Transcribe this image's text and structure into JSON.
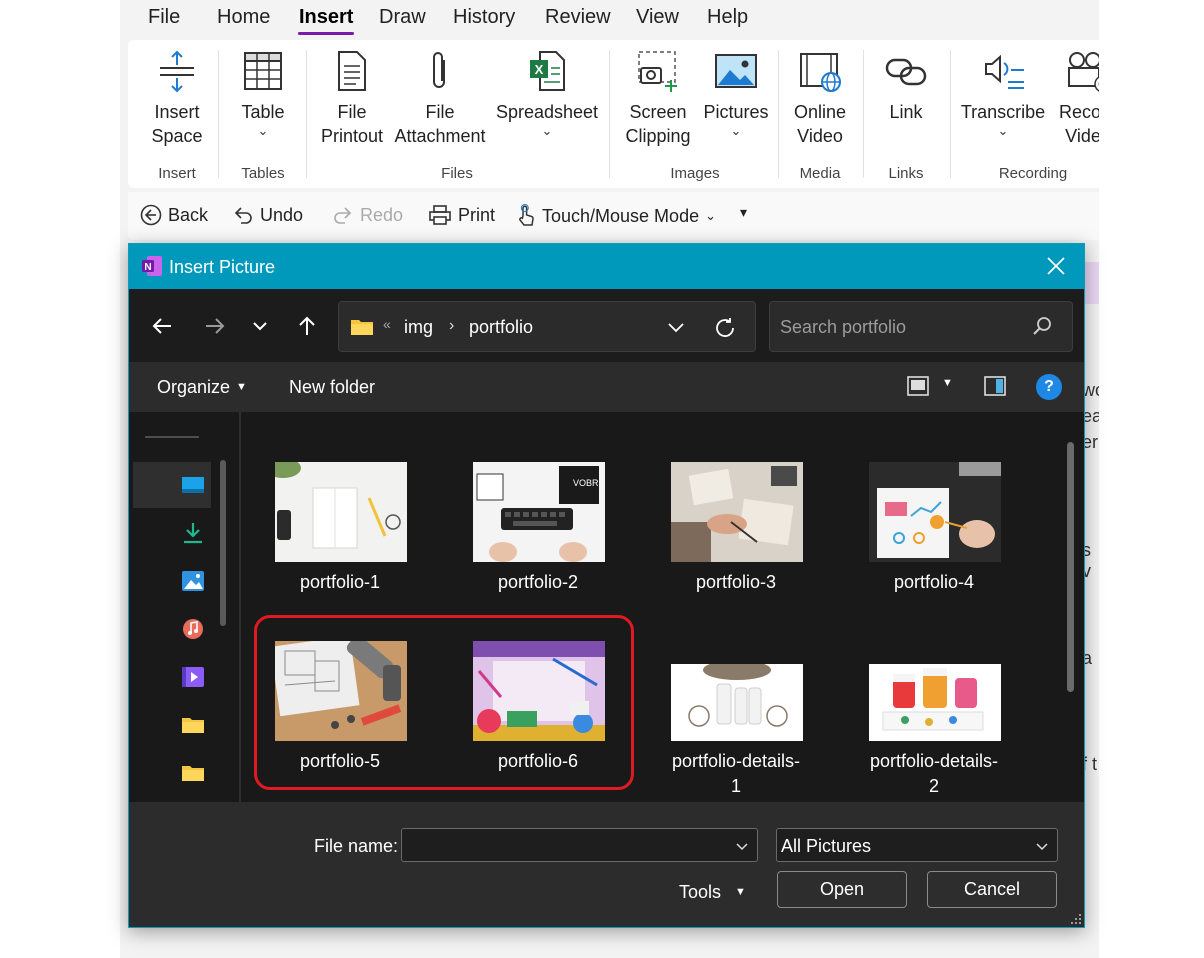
{
  "menubar": {
    "items": [
      "File",
      "Home",
      "Insert",
      "Draw",
      "History",
      "Review",
      "View",
      "Help"
    ],
    "active": "Insert"
  },
  "ribbon": {
    "buttons": {
      "insert_space": "Insert\nSpace",
      "table": "Table",
      "file_printout": "File\nPrintout",
      "file_attachment": "File\nAttachment",
      "spreadsheet": "Spreadsheet",
      "screen_clipping": "Screen\nClipping",
      "pictures": "Pictures",
      "online_video": "Online\nVideo",
      "link": "Link",
      "transcribe": "Transcribe",
      "record_video": "Record\nVideo"
    },
    "groups": {
      "insert": "Insert",
      "tables": "Tables",
      "files": "Files",
      "images": "Images",
      "media": "Media",
      "links": "Links",
      "recording": "Recording"
    }
  },
  "quick_access": {
    "back": "Back",
    "undo": "Undo",
    "redo": "Redo",
    "print": "Print",
    "touch_mode": "Touch/Mouse Mode"
  },
  "background_text": [
    "wo",
    "ea",
    "er",
    "s v",
    "a",
    "f t"
  ],
  "dialog": {
    "title": "Insert Picture",
    "address": {
      "overflow": "«",
      "segments": [
        "img",
        "portfolio"
      ]
    },
    "search_placeholder": "Search portfolio",
    "commands": {
      "organize": "Organize",
      "new_folder": "New folder"
    },
    "files": [
      {
        "name": "portfolio-1",
        "selected": false
      },
      {
        "name": "portfolio-2",
        "selected": false
      },
      {
        "name": "portfolio-3",
        "selected": false
      },
      {
        "name": "portfolio-4",
        "selected": false
      },
      {
        "name": "portfolio-5",
        "selected": true
      },
      {
        "name": "portfolio-6",
        "selected": true
      },
      {
        "name": "portfolio-details-\n1",
        "selected": false
      },
      {
        "name": "portfolio-details-\n2",
        "selected": false
      }
    ],
    "footer": {
      "file_name_label": "File name:",
      "file_name_value": "",
      "file_type": "All Pictures",
      "tools": "Tools",
      "open": "Open",
      "cancel": "Cancel"
    }
  },
  "colors": {
    "accent_purple": "#7719aa",
    "dialog_titlebar": "#0099bc",
    "highlight_red": "#e01a22"
  }
}
